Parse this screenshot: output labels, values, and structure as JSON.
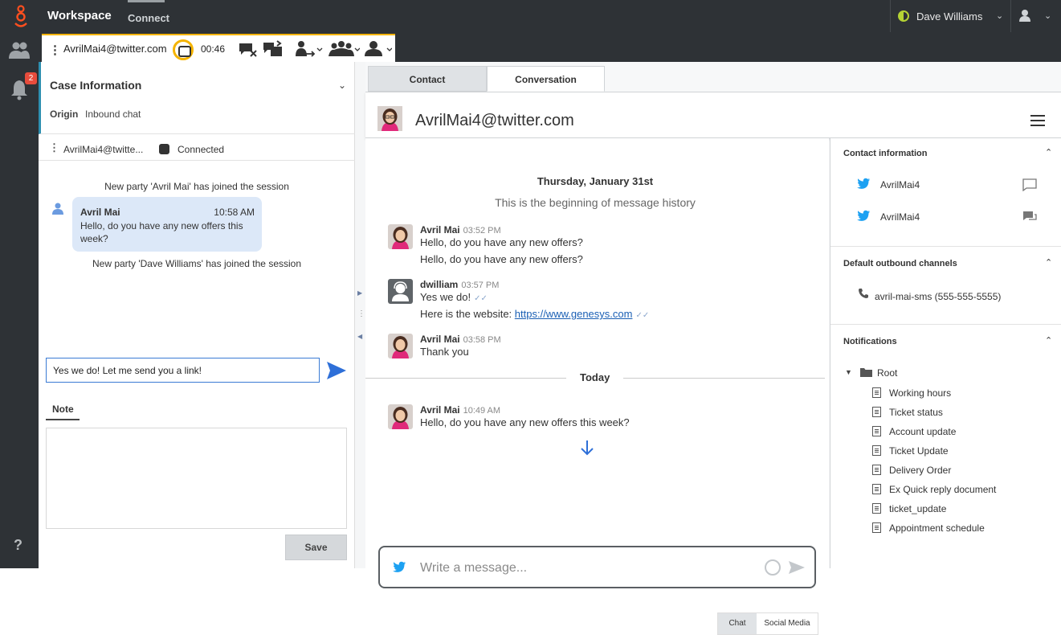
{
  "topbar": {
    "app_name": "Workspace",
    "connect_tab": "Connect",
    "user_name": "Dave Williams"
  },
  "leftnav": {
    "notification_count": "2",
    "help_label": "?"
  },
  "interaction": {
    "contact": "AvrilMai4@twitter.com",
    "timer": "00:46",
    "accent_color": "#f5b400"
  },
  "case": {
    "title": "Case Information",
    "origin_label": "Origin",
    "origin_value": "Inbound chat",
    "party_name": "AvrilMai4@twitte...",
    "party_status": "Connected"
  },
  "transcript": {
    "joined_1": "New party 'Avril Mai' has joined the session",
    "bubble_name": "Avril Mai",
    "bubble_time": "10:58 AM",
    "bubble_text": "Hello, do you have any new offers this week?",
    "joined_2": "New party 'Dave Williams' has joined the session"
  },
  "reply": {
    "value": "Yes we do! Let me send you a link!"
  },
  "note": {
    "tab_label": "Note",
    "save_label": "Save"
  },
  "tabs": {
    "contact": "Contact",
    "conversation": "Conversation"
  },
  "conversation": {
    "title": "AvrilMai4@twitter.com",
    "date_heading": "Thursday, January 31st",
    "history_begin": "This is the beginning of message history",
    "today_label": "Today",
    "messages": [
      {
        "author": "Avril Mai",
        "time": "03:52 PM",
        "lines": [
          "Hello, do you have any new offers?",
          "Hello, do you have any new offers?"
        ]
      },
      {
        "author": "dwilliam",
        "time": "03:57 PM",
        "line1": "Yes we do!",
        "line2_prefix": "Here is the website: ",
        "link": "https://www.genesys.com"
      },
      {
        "author": "Avril Mai",
        "time": "03:58 PM",
        "lines": [
          "Thank you"
        ]
      },
      {
        "author": "Avril Mai",
        "time": "10:49 AM",
        "lines": [
          "Hello, do you have any new offers this week?"
        ]
      }
    ],
    "compose_placeholder": "Write a message...",
    "bottom_tabs": [
      "Chat",
      "Social Media"
    ]
  },
  "side_panel": {
    "contact_info_title": "Contact information",
    "handles": [
      "AvrilMai4",
      "AvrilMai4"
    ],
    "outbound_title": "Default outbound channels",
    "outbound_channel": "avril-mai-sms (555-555-5555)",
    "notifications_title": "Notifications",
    "root_label": "Root",
    "documents": [
      "Working hours",
      "Ticket status",
      "Account update",
      "Ticket Update",
      "Delivery Order",
      "Ex Quick reply document",
      "ticket_update",
      "Appointment schedule"
    ]
  },
  "colors": {
    "twitter_blue": "#1da1f2",
    "send_blue": "#2e6fd8",
    "status_green": "#b5d334"
  },
  "icons": [
    "genesys-logo-icon",
    "status-dot-icon",
    "chevron-down-icon",
    "agent-icon",
    "contacts-icon",
    "bell-icon",
    "help-icon",
    "kebab-icon",
    "chat-icon",
    "end-chat-icon",
    "transfer-icon",
    "consult-icon",
    "conference-icon",
    "user-icon",
    "send-icon",
    "avatar-icon",
    "hamburger-icon",
    "twitter-icon",
    "emoji-icon",
    "phone-icon",
    "folder-icon",
    "document-icon",
    "down-arrow-icon"
  ]
}
